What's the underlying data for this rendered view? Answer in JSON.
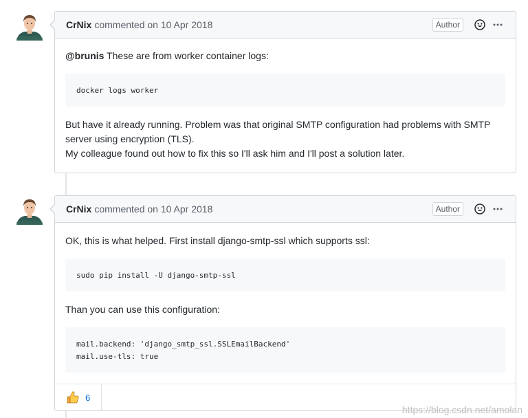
{
  "comments": [
    {
      "author": "CrNix",
      "meta": "commented on 10 Apr 2018",
      "badge": "Author",
      "mention": "@brunis",
      "intro": " These are from worker container logs:",
      "code1": "docker logs worker",
      "para1": "But have it already running. Problem was that original SMTP configuration had problems with SMTP server using encryption (TLS).",
      "para2": "My colleague found out how to fix this so I'll ask him and I'll post a solution later."
    },
    {
      "author": "CrNix",
      "meta": "commented on 10 Apr 2018",
      "badge": "Author",
      "intro": "OK, this is what helped. First install django-smtp-ssl which supports ssl:",
      "code1": "sudo pip install -U django-smtp-ssl",
      "para1": "Than you can use this configuration:",
      "code2": "mail.backend: 'django_smtp_ssl.SSLEmailBackend'\nmail.use-tls: true",
      "reaction_count": "6"
    }
  ],
  "icons": {
    "avatar": "avatar-icon",
    "emoji": "smiley-icon",
    "more": "kebab-horizontal-icon",
    "reaction": "thumbs-up-icon"
  },
  "watermark": "https://blog.csdn.net/amolan"
}
